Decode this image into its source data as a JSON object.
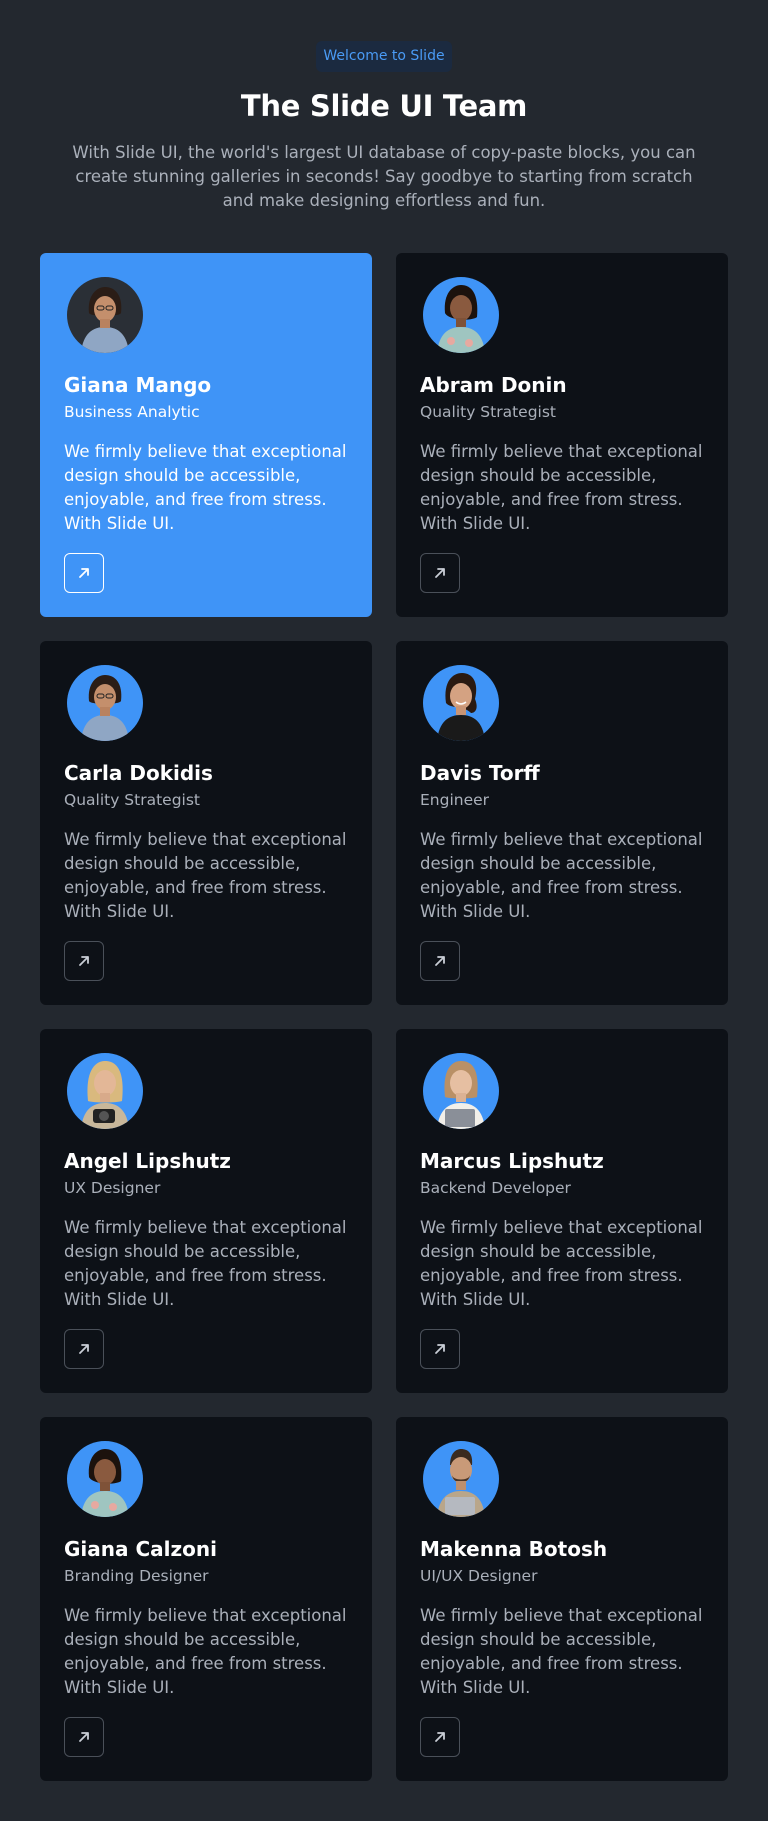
{
  "header": {
    "badge": "Welcome to Slide",
    "title": "The Slide UI Team",
    "subtitle": "With Slide UI, the world's largest UI database of copy-paste blocks, you can create stunning galleries in seconds! Say goodbye to starting from scratch and make designing effortless and fun."
  },
  "colors": {
    "background": "#23282f",
    "card": "#0d1117",
    "accent": "#3f94f7",
    "muted_text": "#aab0ba"
  },
  "team": [
    {
      "name": "Giana Mango",
      "role": "Business Analytic",
      "description": "We firmly believe that exceptional design should be accessible, enjoyable, and free from stress. With Slide UI.",
      "icon": "arrow-up-right-icon"
    },
    {
      "name": "Abram Donin",
      "role": "Quality Strategist",
      "description": "We firmly believe that exceptional design should be accessible, enjoyable, and free from stress. With Slide UI.",
      "icon": "arrow-up-right-icon"
    },
    {
      "name": "Carla Dokidis",
      "role": "Quality Strategist",
      "description": "We firmly believe that exceptional design should be accessible, enjoyable, and free from stress. With Slide UI.",
      "icon": "arrow-up-right-icon"
    },
    {
      "name": "Davis Torff",
      "role": "Engineer",
      "description": "We firmly believe that exceptional design should be accessible, enjoyable, and free from stress. With Slide UI.",
      "icon": "arrow-up-right-icon"
    },
    {
      "name": "Angel Lipshutz",
      "role": "UX Designer",
      "description": "We firmly believe that exceptional design should be accessible, enjoyable, and free from stress. With Slide UI.",
      "icon": "arrow-up-right-icon"
    },
    {
      "name": "Marcus Lipshutz",
      "role": "Backend Developer",
      "description": "We firmly believe that exceptional design should be accessible, enjoyable, and free from stress. With Slide UI.",
      "icon": "arrow-up-right-icon"
    },
    {
      "name": "Giana Calzoni",
      "role": "Branding Designer",
      "description": "We firmly believe that exceptional design should be accessible, enjoyable, and free from stress. With Slide UI.",
      "icon": "arrow-up-right-icon"
    },
    {
      "name": "Makenna Botosh",
      "role": "UI/UX Designer",
      "description": "We firmly believe that exceptional design should be accessible, enjoyable, and free from stress. With Slide UI.",
      "icon": "arrow-up-right-icon"
    }
  ]
}
